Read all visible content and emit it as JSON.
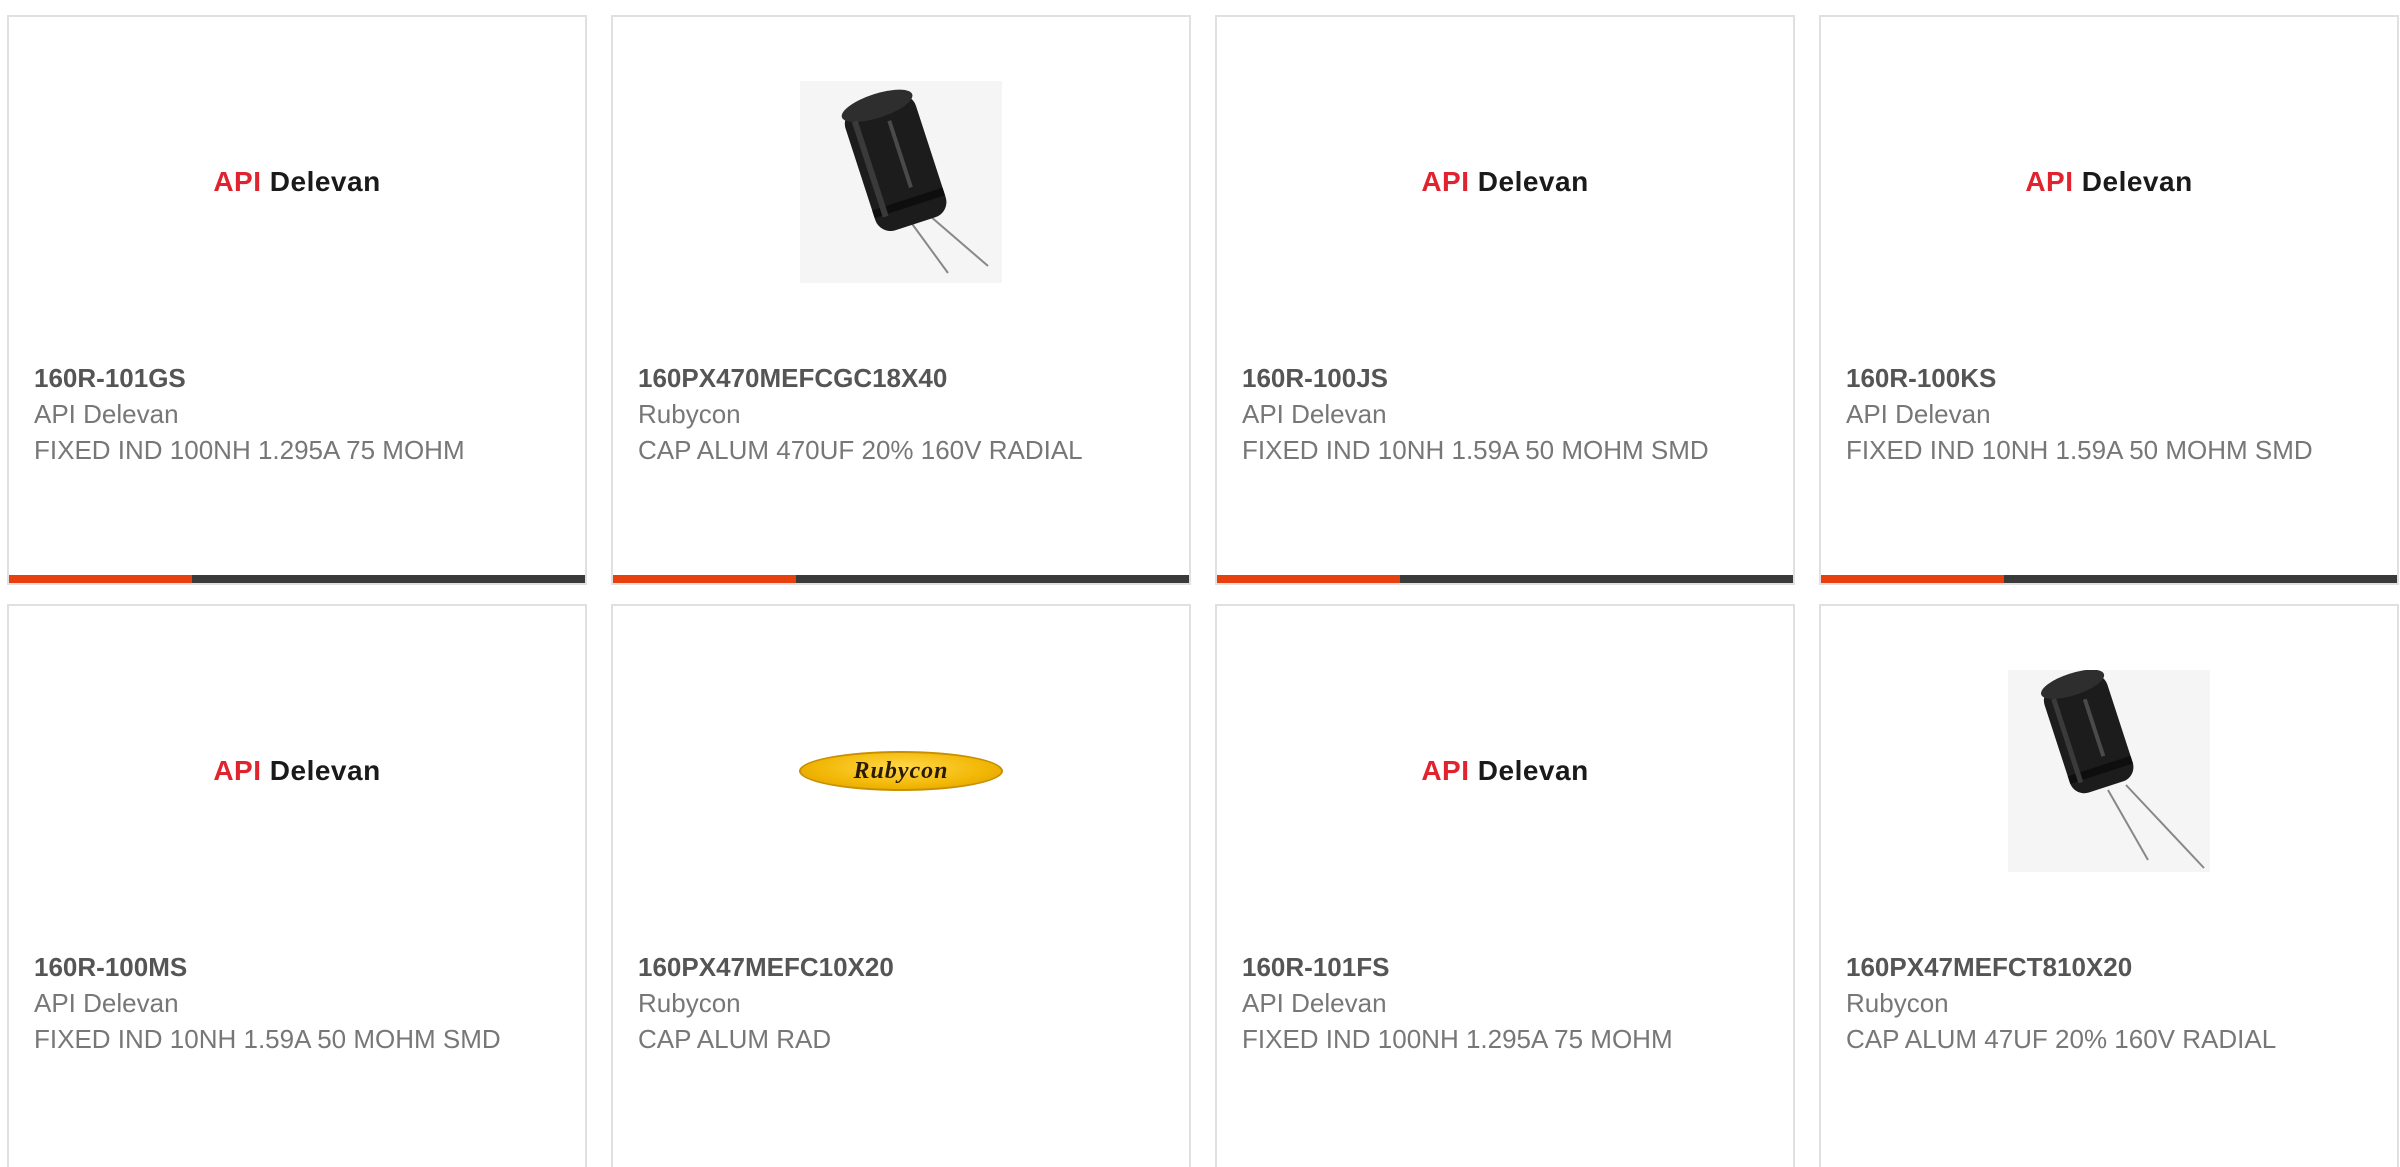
{
  "products": [
    {
      "part": "160R-101GS",
      "manufacturer": "API Delevan",
      "description": "FIXED IND 100NH 1.295A 75 MOHM",
      "image": "api-delevan-logo"
    },
    {
      "part": "160PX470MEFCGC18X40",
      "manufacturer": "Rubycon",
      "description": "CAP ALUM 470UF 20% 160V RADIAL",
      "image": "capacitor-photo"
    },
    {
      "part": "160R-100JS",
      "manufacturer": "API Delevan",
      "description": "FIXED IND 10NH 1.59A 50 MOHM SMD",
      "image": "api-delevan-logo"
    },
    {
      "part": "160R-100KS",
      "manufacturer": "API Delevan",
      "description": "FIXED IND 10NH 1.59A 50 MOHM SMD",
      "image": "api-delevan-logo"
    },
    {
      "part": "160R-100MS",
      "manufacturer": "API Delevan",
      "description": "FIXED IND 10NH 1.59A 50 MOHM SMD",
      "image": "api-delevan-logo"
    },
    {
      "part": "160PX47MEFC10X20",
      "manufacturer": "Rubycon",
      "description": "CAP ALUM RAD",
      "image": "rubycon-logo"
    },
    {
      "part": "160R-101FS",
      "manufacturer": "API Delevan",
      "description": "FIXED IND 100NH 1.295A 75 MOHM",
      "image": "api-delevan-logo"
    },
    {
      "part": "160PX47MEFCT810X20",
      "manufacturer": "Rubycon",
      "description": "CAP ALUM 47UF 20% 160V RADIAL",
      "image": "capacitor-photo"
    }
  ],
  "logos": {
    "api": "API",
    "delevan": "Delevan",
    "rubycon": "Rubycon"
  },
  "colors": {
    "accent": "#e6400f",
    "bar": "#3a3a3a",
    "api_red": "#e0232e",
    "rubycon_yellow": "#f2b705"
  }
}
